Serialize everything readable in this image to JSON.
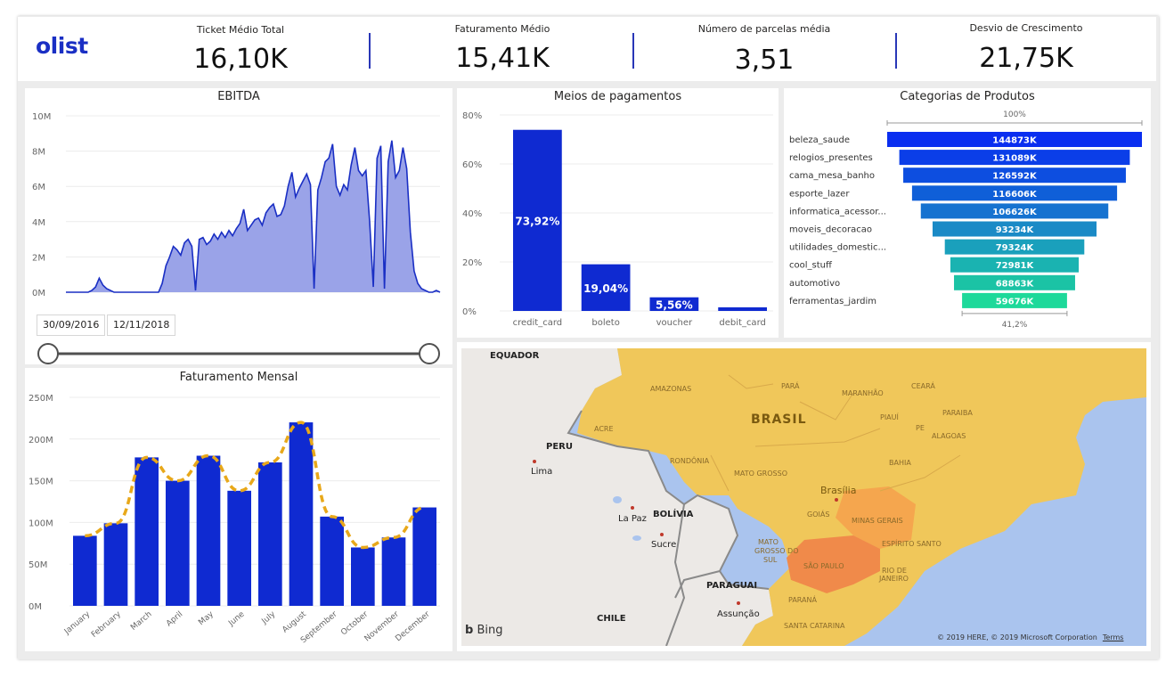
{
  "brand": {
    "logo": "olist"
  },
  "kpis": [
    {
      "label": "Ticket Médio Total",
      "value": "16,10K"
    },
    {
      "label": "Faturamento Médio",
      "value": "15,41K"
    },
    {
      "label": "Número de parcelas média",
      "value": "3,51"
    },
    {
      "label": "Desvio de Crescimento",
      "value": "21,75K"
    }
  ],
  "ebitda": {
    "title": "EBITDA",
    "yticks": [
      "10M",
      "8M",
      "6M",
      "4M",
      "2M",
      "0M"
    ],
    "date_start": "30/09/2016",
    "date_end": "12/11/2018",
    "fill_color": "#9aa3e8",
    "line_color": "#1a2fc4"
  },
  "payments": {
    "title": "Meios de pagamentos",
    "yticks": [
      "80%",
      "60%",
      "40%",
      "20%",
      "0%"
    ],
    "bar_color": "#0f2ad1"
  },
  "categories": {
    "title": "Categorias de Produtos",
    "top_label": "100%",
    "bottom_label": "41,2%"
  },
  "revenue": {
    "title": "Faturamento Mensal",
    "yticks": [
      "250M",
      "200M",
      "150M",
      "100M",
      "50M",
      "0M"
    ],
    "bar_color": "#0f2ad1",
    "line_color": "#e8a81a"
  },
  "map": {
    "attribution": "© 2019 HERE, © 2019 Microsoft Corporation",
    "terms": "Terms",
    "bing": "Bing",
    "labels": {
      "equador": "EQUADOR",
      "peru": "PERU",
      "lima": "Lima",
      "bolivia": "BOLÍVIA",
      "lapaz": "La Paz",
      "sucre": "Sucre",
      "paraguai": "PARAGUAI",
      "assuncao": "Assunção",
      "chile": "CHILE",
      "brasil": "BRASIL",
      "amazonas": "AMAZONAS",
      "para": "PARÁ",
      "maranhao": "MARANHÃO",
      "ceara": "CEARÁ",
      "piaui": "PIAUÍ",
      "paraiba": "PARAIBA",
      "pernambuco": "PE",
      "alagoas": "ALAGOAS",
      "acre": "ACRE",
      "bahia": "BAHIA",
      "rondonia": "RONDÔNIA",
      "matogrosso": "MATO GROSSO",
      "brasilia": "Brasília",
      "goias": "GOIÁS",
      "minas": "MINAS GERAIS",
      "espirito": "ESPÍRITO SANTO",
      "mgs1": "MATO",
      "mgs2": "GROSSO DO",
      "mgs3": "SUL",
      "saopaulo": "SÃO PAULO",
      "rio1": "RIO DE",
      "rio2": "JANEIRO",
      "parana": "PARANÁ",
      "santacatarina": "SANTA CATARINA"
    }
  },
  "chart_data": [
    {
      "type": "area",
      "title": "EBITDA",
      "xlabel": "",
      "ylabel": "",
      "ylim": [
        0,
        10
      ],
      "y_unit": "M",
      "x_range": [
        "30/09/2016",
        "12/11/2018"
      ],
      "values": [
        0,
        0,
        0,
        0,
        0,
        0,
        0,
        0.1,
        0.3,
        0.8,
        0.4,
        0.2,
        0.1,
        0,
        0,
        0,
        0,
        0,
        0,
        0,
        0,
        0,
        0,
        0,
        0,
        0,
        0.5,
        1.5,
        2.0,
        2.6,
        2.4,
        2.1,
        2.8,
        3.0,
        2.6,
        0.1,
        3.0,
        3.1,
        2.7,
        2.9,
        3.3,
        3.0,
        3.4,
        3.1,
        3.5,
        3.2,
        3.6,
        3.9,
        4.7,
        3.5,
        3.8,
        4.1,
        4.2,
        3.8,
        4.5,
        4.8,
        5.0,
        4.3,
        4.4,
        4.9,
        6.0,
        6.8,
        5.4,
        5.9,
        6.3,
        6.7,
        6.1,
        0.2,
        5.8,
        6.5,
        7.4,
        7.6,
        8.4,
        6.0,
        5.5,
        6.1,
        5.8,
        7.2,
        8.2,
        6.9,
        6.6,
        6.9,
        4.0,
        0.3,
        7.6,
        8.3,
        0.2,
        7.4,
        8.6,
        6.5,
        6.9,
        8.2,
        7.0,
        3.4,
        1.2,
        0.5,
        0.2,
        0.1,
        0,
        0,
        0.1,
        0
      ],
      "color": "#1a2fc4"
    },
    {
      "type": "bar",
      "title": "Meios de pagamentos",
      "categories": [
        "credit_card",
        "boleto",
        "voucher",
        "debit_card"
      ],
      "values": [
        73.92,
        19.04,
        5.56,
        1.48
      ],
      "data_labels": [
        "73,92%",
        "19,04%",
        "5,56%",
        ""
      ],
      "ylim": [
        0,
        80
      ],
      "y_unit": "%"
    },
    {
      "type": "bar",
      "title": "Categorias de Produtos",
      "orientation": "funnel",
      "categories": [
        "beleza_saude",
        "relogios_presentes",
        "cama_mesa_banho",
        "esporte_lazer",
        "informatica_acessor...",
        "moveis_decoracao",
        "utilidades_domestic...",
        "cool_stuff",
        "automotivo",
        "ferramentas_jardim"
      ],
      "values": [
        144873,
        131089,
        126592,
        116606,
        106626,
        93234,
        79324,
        72981,
        68863,
        59676
      ],
      "data_labels": [
        "144873K",
        "131089K",
        "126592K",
        "116606K",
        "106626K",
        "93234K",
        "79324K",
        "72981K",
        "68863K",
        "59676K"
      ],
      "colors": [
        "#0a2ef0",
        "#0b3ee8",
        "#0d4ee0",
        "#0f5fd8",
        "#1572d0",
        "#1a8ac6",
        "#1aa0bc",
        "#1ab3b1",
        "#1bc3a5",
        "#1dd99a"
      ]
    },
    {
      "type": "bar",
      "title": "Faturamento Mensal",
      "categories": [
        "January",
        "February",
        "March",
        "April",
        "May",
        "June",
        "July",
        "August",
        "September",
        "October",
        "November",
        "December"
      ],
      "series": [
        {
          "type": "bar",
          "values": [
            84,
            99,
            178,
            150,
            180,
            138,
            172,
            220,
            107,
            70,
            82,
            118
          ]
        },
        {
          "type": "line",
          "values": [
            84,
            99,
            178,
            150,
            180,
            138,
            172,
            220,
            107,
            70,
            82,
            118
          ]
        }
      ],
      "ylim": [
        0,
        250
      ],
      "y_unit": "M"
    }
  ]
}
